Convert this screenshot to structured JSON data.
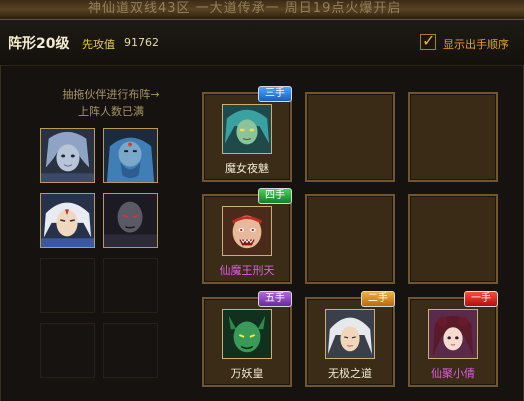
{
  "banner": {
    "text": "神仙道双线43区 一大道传承一 周日19点火爆开启"
  },
  "header": {
    "title": "阵形20级",
    "attack_label": "先攻值",
    "attack_value": "91762",
    "show_order_label": "显示出手顺序",
    "show_order_checked": true
  },
  "hint": {
    "line1": "抽拖伙伴进行布阵→",
    "line2": "上阵人数已满"
  },
  "roster": [
    {
      "name": "blue-haired-female-portrait",
      "filled": true
    },
    {
      "name": "blue-bearded-elder-portrait",
      "filled": true
    },
    {
      "name": "white-haired-male-portrait",
      "filled": true
    },
    {
      "name": "dark-skinned-warrior-portrait",
      "filled": true
    },
    {
      "name": "empty",
      "filled": false
    },
    {
      "name": "empty",
      "filled": false
    },
    {
      "name": "empty",
      "filled": false
    },
    {
      "name": "empty",
      "filled": false
    }
  ],
  "grid": {
    "cell_1": {
      "hero": "魔女夜魅",
      "order": "三手",
      "order_color": "#1a5fc0",
      "name_color": "#f2ead4"
    },
    "cell_4": {
      "hero": "仙魔王刑天",
      "order": "四手",
      "order_color": "#1b7a2a",
      "name_color": "#e05be0"
    },
    "cell_7": {
      "hero": "万妖皇",
      "order": "五手",
      "order_color": "#6a2a9a",
      "name_color": "#f2ead4"
    },
    "cell_8": {
      "hero": "无极之道",
      "order": "二手",
      "order_color": "#b86a10",
      "name_color": "#f2ead4"
    },
    "cell_9": {
      "hero": "仙聚小倩",
      "order": "一手",
      "order_color": "#b01010",
      "name_color": "#e05be0"
    }
  }
}
